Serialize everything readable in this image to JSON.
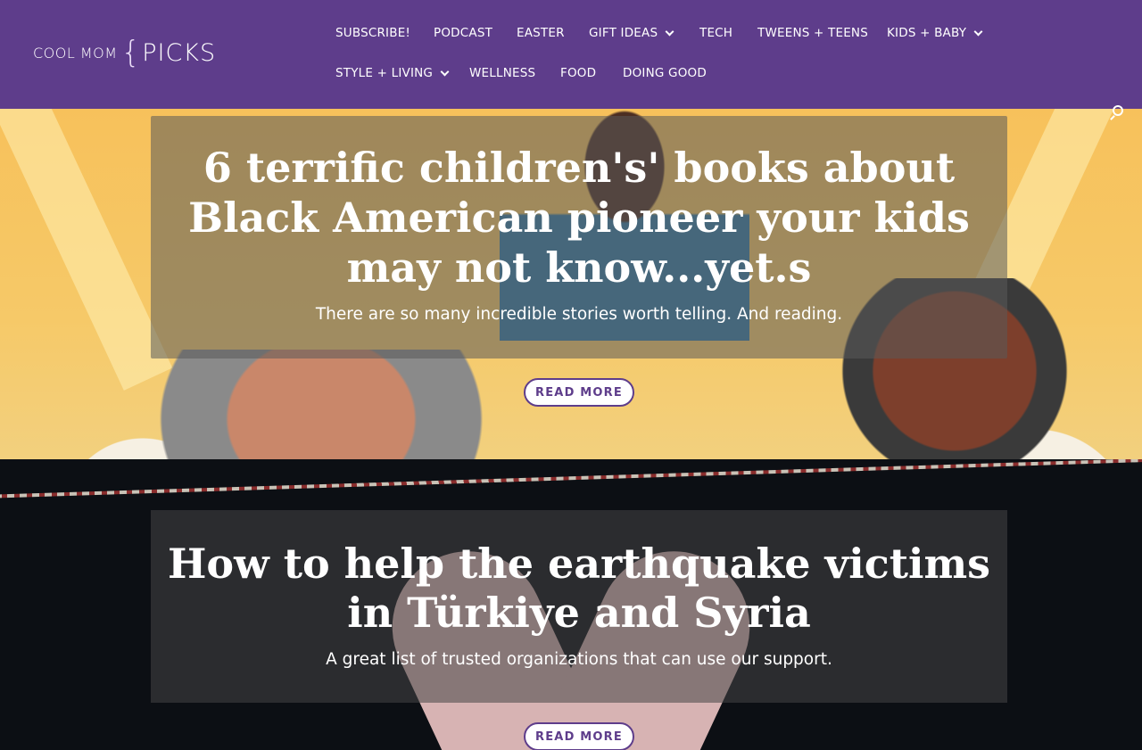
{
  "header": {
    "logo": {
      "small": "COOL MOM",
      "brace": "{",
      "big": "PICKS"
    },
    "nav": [
      {
        "label": "SUBSCRIBE!",
        "has_dropdown": false
      },
      {
        "label": "PODCAST",
        "has_dropdown": false
      },
      {
        "label": "EASTER",
        "has_dropdown": false
      },
      {
        "label": "GIFT IDEAS",
        "has_dropdown": true
      },
      {
        "label": "TECH",
        "has_dropdown": false
      },
      {
        "label": "TWEENS + TEENS",
        "has_dropdown": false
      },
      {
        "label": "KIDS + BABY",
        "has_dropdown": true
      },
      {
        "label": "STYLE + LIVING",
        "has_dropdown": true
      },
      {
        "label": "WELLNESS",
        "has_dropdown": false
      },
      {
        "label": "FOOD",
        "has_dropdown": false
      },
      {
        "label": "DOING GOOD",
        "has_dropdown": false
      }
    ],
    "colors": {
      "background": "#5e3d8b",
      "text": "#ffffff"
    },
    "search_icon": "search-icon"
  },
  "posts": [
    {
      "title": "6 terrific children's' books about Black American pioneer your kids may not know...yet.s",
      "excerpt": "There are so many incredible stories worth telling. And reading.",
      "button": "READ MORE"
    },
    {
      "title": "How to help the earthquake victims in Türkiye and Syria",
      "excerpt": "A great list of trusted organizations that can use our support.",
      "button": "READ MORE"
    }
  ]
}
